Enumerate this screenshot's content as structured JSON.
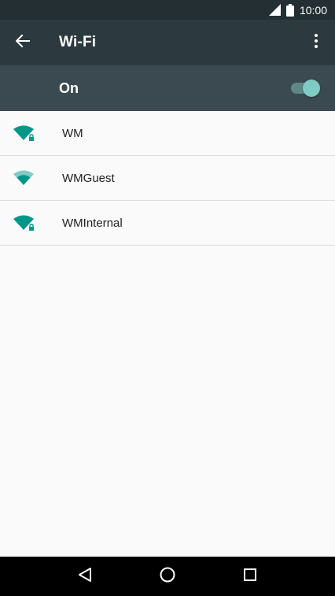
{
  "status_bar": {
    "time": "10:00",
    "icons": [
      "signal-icon",
      "battery-icon"
    ]
  },
  "app_bar": {
    "title": "Wi-Fi",
    "icons": [
      "back-arrow-icon",
      "overflow-menu-icon"
    ]
  },
  "master_switch": {
    "label": "On",
    "enabled": true
  },
  "colors": {
    "status_bar": "#242f33",
    "app_bar": "#2c3a40",
    "switch_bar": "#3a4a50",
    "accent": "#009688",
    "toggle_thumb": "#80cbc4"
  },
  "networks": [
    {
      "ssid": "WM",
      "secured": true,
      "signal": "full"
    },
    {
      "ssid": "WMGuest",
      "secured": false,
      "signal": "medium"
    },
    {
      "ssid": "WMInternal",
      "secured": true,
      "signal": "full"
    }
  ],
  "nav_bar": {
    "icons": [
      "back-triangle-icon",
      "home-circle-icon",
      "recents-square-icon"
    ]
  }
}
